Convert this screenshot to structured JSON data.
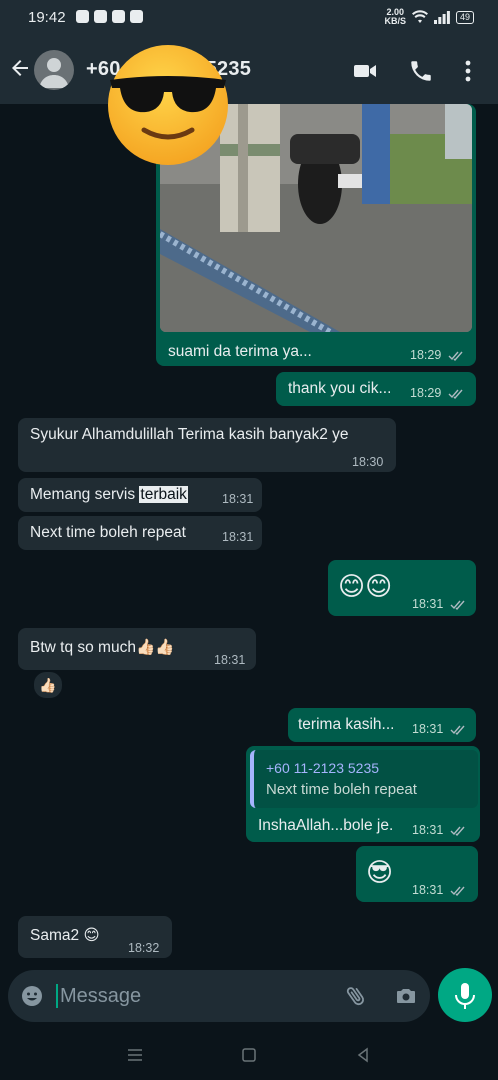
{
  "status_bar": {
    "time": "19:42",
    "net_speed_value": "2.00",
    "net_speed_unit": "KB/S",
    "battery": "49"
  },
  "header": {
    "contact_name": "+60 11-2123 5235"
  },
  "messages": [
    {
      "id": "m1",
      "dir": "out",
      "type": "image",
      "caption": "suami da terima ya...",
      "time": "18:29"
    },
    {
      "id": "m2",
      "dir": "out",
      "text": "thank you cik...",
      "time": "18:29"
    },
    {
      "id": "m3",
      "dir": "in",
      "text": "Syukur Alhamdulillah Terima kasih banyak2 ye",
      "time": "18:30"
    },
    {
      "id": "m4",
      "dir": "in",
      "text_pre": "Memang servis ",
      "text_highlight": "terbaik",
      "time": "18:31"
    },
    {
      "id": "m5",
      "dir": "in",
      "text": "Next time boleh repeat",
      "time": "18:31"
    },
    {
      "id": "m6",
      "dir": "out",
      "text": "😊😊",
      "time": "18:31"
    },
    {
      "id": "m7",
      "dir": "in",
      "text": "Btw tq so much👍🏻👍🏻",
      "time": "18:31",
      "reaction": "👍🏻"
    },
    {
      "id": "m8",
      "dir": "out",
      "text": "terima kasih...",
      "time": "18:31"
    },
    {
      "id": "m9",
      "dir": "out",
      "quote_name": "+60 11-2123 5235",
      "quote_text": "Next time boleh repeat",
      "text": "InshaAllah...bole je.",
      "time": "18:31"
    },
    {
      "id": "m10",
      "dir": "out",
      "text": "😎",
      "time": "18:31"
    },
    {
      "id": "m11",
      "dir": "in",
      "text": "Sama2 😊",
      "time": "18:32"
    }
  ],
  "composer": {
    "placeholder": "Message"
  },
  "colors": {
    "incoming_bubble": "#202c33",
    "outgoing_bubble": "#005c4b",
    "accent": "#00a884",
    "background": "#0b141a",
    "header": "#1f2c34"
  },
  "icons": [
    "back-arrow-icon",
    "avatar-icon",
    "video-call-icon",
    "voice-call-icon",
    "more-options-icon",
    "read-ticks-icon",
    "emoji-icon",
    "attach-icon",
    "camera-icon",
    "mic-icon",
    "nav-menu-icon",
    "nav-home-icon",
    "nav-back-icon"
  ]
}
